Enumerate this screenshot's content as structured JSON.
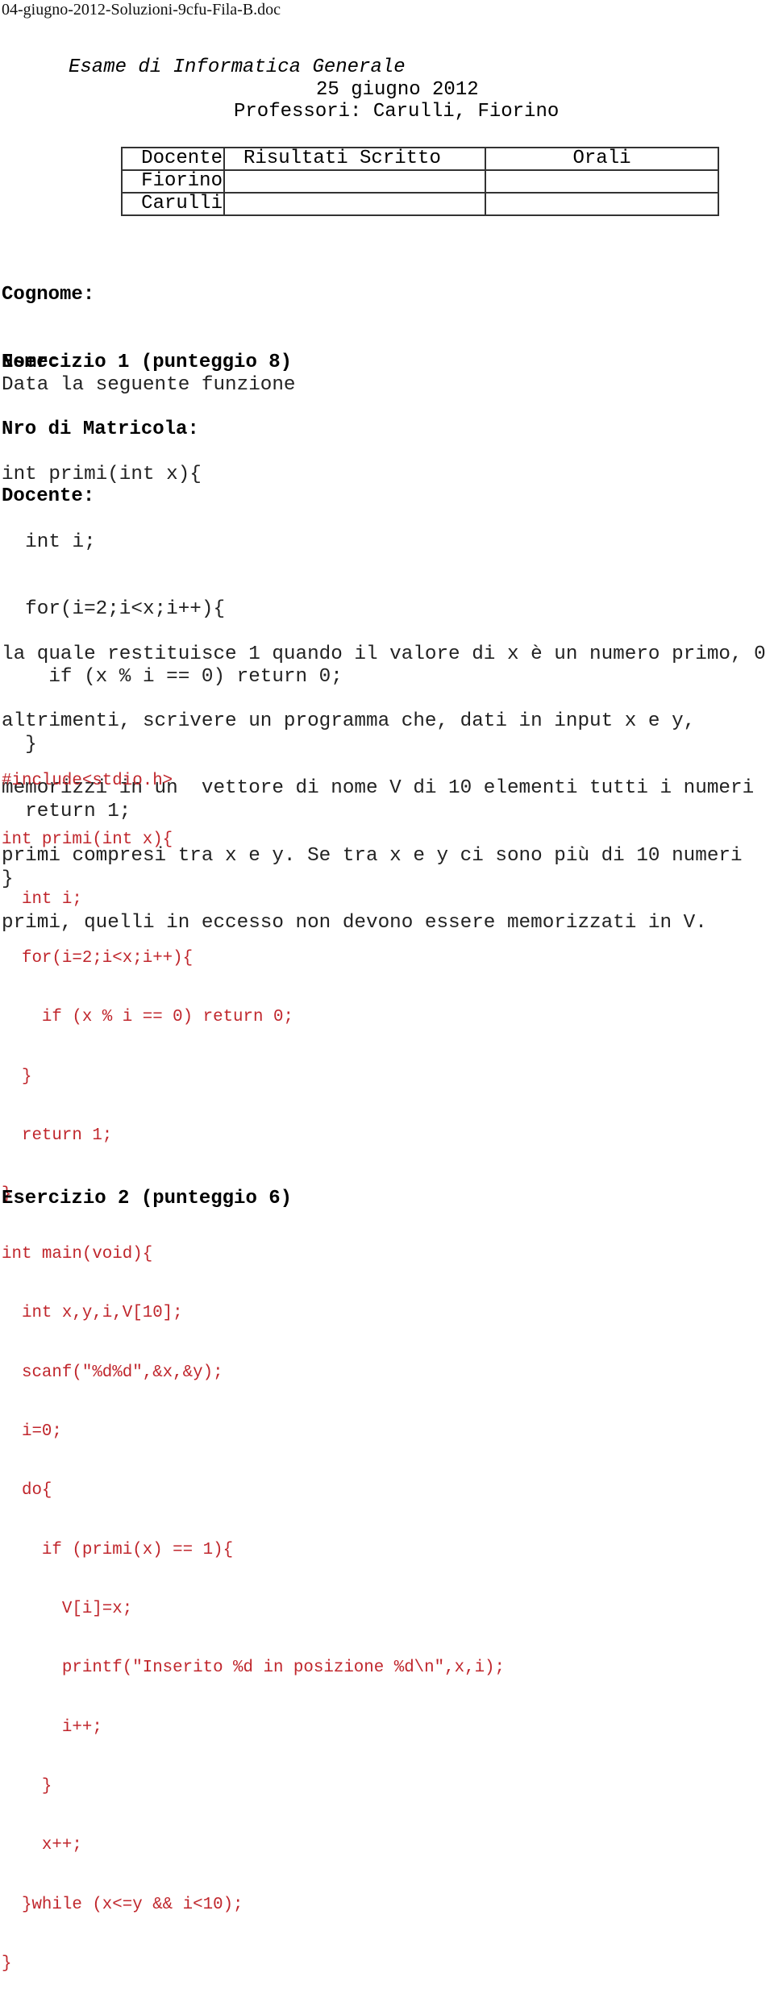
{
  "document": {
    "filename": "04-giugno-2012-Soluzioni-9cfu-Fila-B.doc"
  },
  "header": {
    "title": "Esame di Informatica Generale",
    "date": "25 giugno 2012",
    "professors": "Professori: Carulli, Fiorino"
  },
  "grades_table": {
    "headers": [
      "Docente",
      "Risultati Scritto",
      "Orali"
    ],
    "rows": [
      [
        "Fiorino",
        "",
        ""
      ],
      [
        "Carulli",
        "",
        ""
      ]
    ]
  },
  "student_fields": [
    {
      "label": "Cognome:",
      "value": ""
    },
    {
      "label": "Nome:",
      "value": ""
    },
    {
      "label": "Nro di Matricola:",
      "value": ""
    },
    {
      "label": "Docente:",
      "value": ""
    }
  ],
  "exercise1": {
    "title": "Esercizio 1 (punteggio 8)",
    "intro": "Data la seguente funzione",
    "given_code": [
      "int primi(int x){",
      "  int i;",
      "  for(i=2;i<x;i++){",
      "    if (x % i == 0) return 0;",
      "  }",
      "  return 1;",
      "}"
    ],
    "description": [
      "la quale restituisce 1 quando il valore di x è un numero primo, 0",
      "altrimenti, scrivere un programma che, dati in input x e y,",
      "memorizzi in un  vettore di nome V di 10 elementi tutti i numeri",
      "primi compresi tra x e y. Se tra x e y ci sono più di 10 numeri",
      "primi, quelli in eccesso non devono essere memorizzati in V."
    ],
    "solution_code": [
      "#include<stdio.h>",
      "int primi(int x){",
      "  int i;",
      "  for(i=2;i<x;i++){",
      "    if (x % i == 0) return 0;",
      "  }",
      "  return 1;",
      "}",
      "int main(void){",
      "  int x,y,i,V[10];",
      "  scanf(\"%d%d\",&x,&y);",
      "  i=0;",
      "  do{",
      "    if (primi(x) == 1){",
      "      V[i]=x;",
      "      printf(\"Inserito %d in posizione %d\\n\",x,i);",
      "      i++;",
      "    }",
      "    x++;",
      "  }while (x<=y && i<10);",
      "}"
    ],
    "solution_color": "#c0262c"
  },
  "exercise2": {
    "title": "Esercizio 2 (punteggio 6)"
  }
}
